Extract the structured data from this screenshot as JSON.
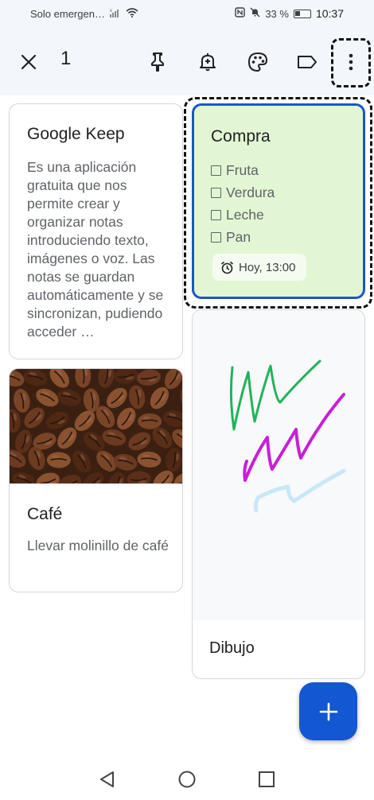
{
  "status_bar": {
    "carrier": "Solo emergen…",
    "battery": "33 %",
    "battery_level": 0.33,
    "time": "10:37"
  },
  "toolbar": {
    "selected_count": "1",
    "icons": [
      "close-icon",
      "pin-icon",
      "add-reminder-icon",
      "palette-icon",
      "label-icon",
      "more-vert-icon"
    ]
  },
  "notes": [
    {
      "title": "Google Keep",
      "body": "Es una aplicación gratuita que nos permite crear y organizar notas introduciendo texto, imágenes o voz. Las notas se guardan automáticamente y se sincronizan, pudiendo acceder …"
    },
    {
      "title": "Compra",
      "checklist": [
        "Fruta",
        "Verdura",
        "Leche",
        "Pan"
      ],
      "reminder": "Hoy, 13:00",
      "color": "#e2f6d3"
    },
    {
      "title": "Café",
      "body": "Llevar molinillo de café"
    },
    {
      "title": "Dibujo"
    }
  ],
  "colors": {
    "accent": "#1457d2",
    "selection_border": "#1a56c8",
    "header_bg": "#f3f6fb"
  }
}
